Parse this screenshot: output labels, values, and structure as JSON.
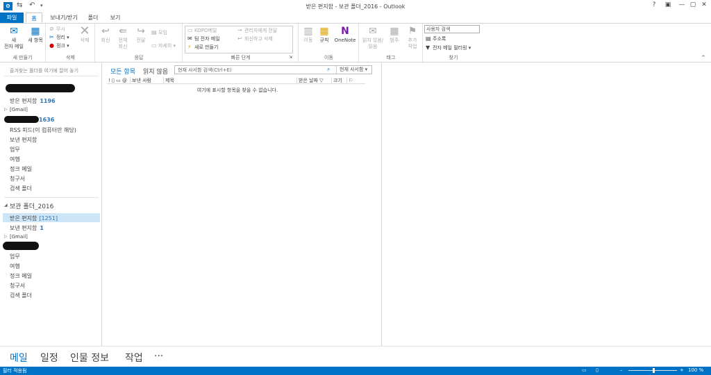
{
  "titlebar": {
    "app_badge": "O",
    "title": "받은 편지함 - 보관 폴더_2016 - Outlook",
    "help": "?",
    "minimize": "—",
    "restore": "▢",
    "close": "✕",
    "ribbon_options": "▣"
  },
  "tabs": [
    "파일",
    "홈",
    "보내기/받기",
    "폴더",
    "보기"
  ],
  "ribbon": {
    "new": {
      "label": "새 만들기",
      "new_email_line1": "새",
      "new_email_line2": "전자 메일",
      "new_items": "새 항목"
    },
    "delete": {
      "label": "삭제",
      "ignore": "무시",
      "cleanup": "정리",
      "junk": "정크",
      "delete": "삭제"
    },
    "respond": {
      "label": "응답",
      "reply": "회신",
      "reply_all_line1": "전체",
      "reply_all_line2": "회신",
      "forward": "전달",
      "meeting": "모임",
      "more": "자세히"
    },
    "quick_steps": {
      "label": "빠른 단계",
      "items": [
        "KOPO메일",
        "팀 전자 메일",
        "새로 만들기",
        "관리자에게 전달",
        "회신하고 삭제"
      ]
    },
    "move": {
      "label": "이동",
      "move": "이동",
      "rules": "규칙",
      "onenote": "OneNote"
    },
    "tags": {
      "label": "태그",
      "unread_read_line1": "읽지 않음/",
      "unread_read_line2": "읽음",
      "categorize": "범주",
      "followup_line1": "추가",
      "followup_line2": "작업"
    },
    "find": {
      "label": "찾기",
      "search_people": "사용자 검색",
      "address_book": "주소록",
      "filter_email": "전자 메일 필터링"
    }
  },
  "nav": {
    "hint": "즐겨찾는 폴더를 여기에 끌어 놓기",
    "account1": {
      "inbox": "받은 편지함",
      "inbox_count": "1196",
      "gmail": "[Gmail]",
      "redacted_count": "1636",
      "folders": [
        "RSS 피드(이 컴퓨터만 해당)",
        "보낸 편지함",
        "업무",
        "여행",
        "정크 메일",
        "청구서",
        "검색 폴더"
      ]
    },
    "archive": {
      "header": "보관 폴더_2016",
      "inbox": "받은 편지함",
      "inbox_count": "[1251]",
      "sent": "보낸 편지함",
      "sent_count": "1",
      "gmail": "[Gmail]",
      "folders": [
        "업무",
        "여행",
        "정크 메일",
        "청구서",
        "검색 폴더"
      ]
    }
  },
  "list": {
    "filter_all": "모든 항목",
    "filter_unread": "읽지 않음",
    "search_placeholder": "현재 사서함 검색(Ctrl+E)",
    "search_scope": "현재 사서함",
    "columns": {
      "icons": "!  ",
      "from": "보낸 사람",
      "subject": "제목",
      "received": "받은 날짜",
      "size": "크기"
    },
    "empty_message": "여기에 표시할 항목을 찾을 수 없습니다."
  },
  "modules": [
    "메일",
    "일정",
    "인물 정보",
    "작업",
    "···"
  ],
  "statusbar": {
    "left": "필터 적용됨",
    "zoom": "100 %"
  },
  "colors": {
    "accent": "#0072c6",
    "selected": "#cde6f7",
    "count": "#2e75b6"
  }
}
